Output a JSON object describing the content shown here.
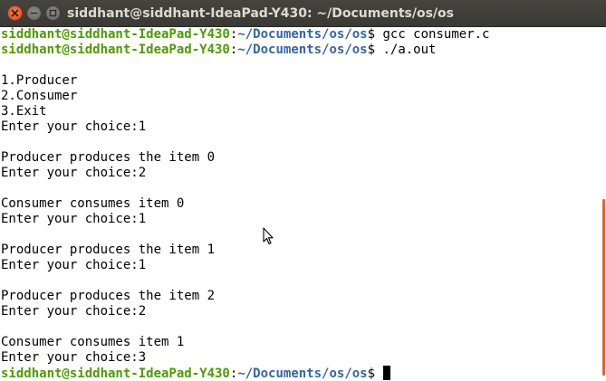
{
  "window": {
    "title": "siddhant@siddhant-IdeaPad-Y430: ~/Documents/os/os",
    "controls": [
      "close-icon",
      "minimize-icon",
      "maximize-icon"
    ]
  },
  "colors": {
    "prompt_user": "#4e9a06",
    "prompt_path": "#3465a4",
    "scroll_thumb": "#e2662b",
    "close_button": "#df4f1e"
  },
  "terminal": {
    "lines": [
      {
        "user": "siddhant@siddhant-IdeaPad-Y430",
        "sep": ":",
        "path": "~/Documents/os/os",
        "dollar": "$ ",
        "cmd": "gcc consumer.c"
      },
      {
        "user": "siddhant@siddhant-IdeaPad-Y430",
        "sep": ":",
        "path": "~/Documents/os/os",
        "dollar": "$ ",
        "cmd": "./a.out"
      },
      {
        "text": ""
      },
      {
        "text": "1.Producer"
      },
      {
        "text": "2.Consumer"
      },
      {
        "text": "3.Exit"
      },
      {
        "text": "Enter your choice:1"
      },
      {
        "text": ""
      },
      {
        "text": "Producer produces the item 0"
      },
      {
        "text": "Enter your choice:2"
      },
      {
        "text": ""
      },
      {
        "text": "Consumer consumes item 0"
      },
      {
        "text": "Enter your choice:1"
      },
      {
        "text": ""
      },
      {
        "text": "Producer produces the item 1"
      },
      {
        "text": "Enter your choice:1"
      },
      {
        "text": ""
      },
      {
        "text": "Producer produces the item 2"
      },
      {
        "text": "Enter your choice:2"
      },
      {
        "text": ""
      },
      {
        "text": "Consumer consumes item 1"
      },
      {
        "text": "Enter your choice:3"
      },
      {
        "user": "siddhant@siddhant-IdeaPad-Y430",
        "sep": ":",
        "path": "~/Documents/os/os",
        "dollar": "$ ",
        "cmd": "",
        "cursor": true
      }
    ]
  }
}
